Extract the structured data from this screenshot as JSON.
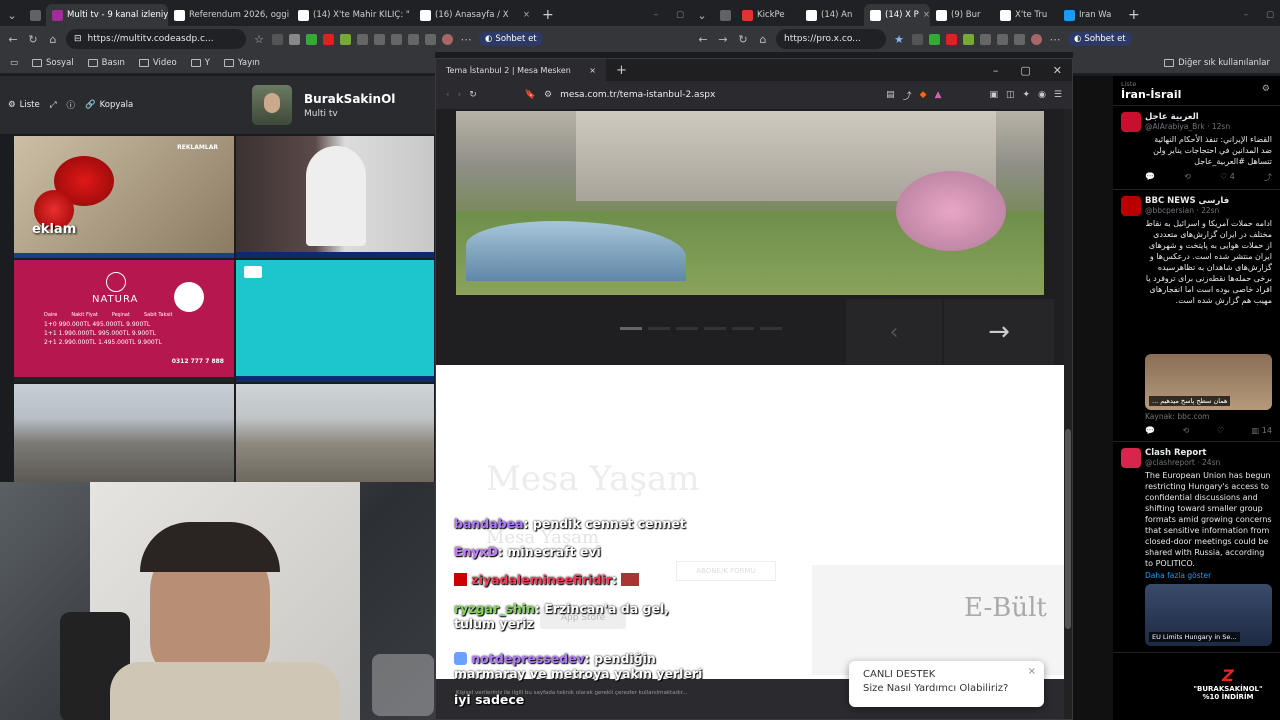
{
  "tabs_left": [
    {
      "label": "",
      "color": "#5f6368"
    },
    {
      "label": "Multi tv - 9 kanal izleniy",
      "color": "#a52a9c",
      "active": true
    },
    {
      "label": "Referendum 2026, oggi",
      "color": "#ffffff"
    },
    {
      "label": "(14) X'te Mahir KILIÇ: \"",
      "color": "#ffffff"
    },
    {
      "label": "(16) Anasayfa / X",
      "color": "#ffffff"
    }
  ],
  "tabs_right": [
    {
      "label": "KickPe",
      "color": "#e0342c"
    },
    {
      "label": "(14) An",
      "color": "#ffffff"
    },
    {
      "label": "(14) X P",
      "color": "#ffffff",
      "active": true
    },
    {
      "label": "(9) Bur",
      "color": "#ffffff"
    },
    {
      "label": "X'te Tru",
      "color": "#ffffff"
    },
    {
      "label": "Iran Wa",
      "color": "#1d9bf0"
    }
  ],
  "url_left": "https://multitv.codeasdp.c...",
  "url_right": "https://pro.x.co...",
  "chat_button": "Sohbet et",
  "bookmarks": [
    "Sosyal",
    "Basın",
    "Video",
    "Y",
    "Yayın"
  ],
  "bookmarks_other": "Diğer sık kullanılanlar",
  "multitv": {
    "liste": "Liste",
    "kopyala": "Kopyala",
    "channel_name": "BurakSakinOl",
    "channel_sub": "Multi tv",
    "reklamlar": "REKLAMLAR",
    "reklam_text": "eklam",
    "natura": "NATURA",
    "natura_phone": "0312 777 7 888",
    "natura_rows": [
      {
        "type": "1+0",
        "price": "990.000TL",
        "down": "495.000TL",
        "monthly": "9.900TL"
      },
      {
        "type": "1+1",
        "price": "1.990.000TL",
        "down": "995.000TL",
        "monthly": "9.900TL"
      },
      {
        "type": "2+1",
        "price": "2.990.000TL",
        "down": "1.495.000TL",
        "monthly": "9.900TL"
      }
    ],
    "natura_headers": [
      "Daire",
      "Nakit Fiyat",
      "Peşinat",
      "Sabit Taksit"
    ]
  },
  "mesa": {
    "tab_title": "Tema İstanbul 2 | Mesa Mesken",
    "url": "mesa.com.tr/tema-istanbul-2.aspx",
    "watermark": "Mesa Yaşam",
    "subscribe": "ABONE/K FORMU",
    "store": "App Store",
    "ebulten": "E-Bült",
    "cookie": "Kişisel verileriniz ile ilgili bu sayfada teknik olarak gerekli çerezler kullanılmaktadır..."
  },
  "chat": [
    {
      "user": "bandabea",
      "user_color": "#b07cff",
      "msg": "pendik cennet cennet"
    },
    {
      "user": "EnyxD",
      "user_color": "#c77dff",
      "msg": "minecraft evi"
    },
    {
      "user": "ziyadaleminеefiridir",
      "user_color": "#ff3b5c",
      "msg": ""
    },
    {
      "user": "ryzgar_shin",
      "user_color": "#7ed957",
      "msg": "Erzincan'a da gel, tulum yeriz"
    },
    {
      "user": "notdepressedev",
      "user_color": "#b07cff",
      "msg": "pendiğin marmaray ve metroya yakın yerleri"
    },
    {
      "user": "",
      "user_color": "#fff",
      "msg": "iyi sadece"
    }
  ],
  "live_support": {
    "title": "CANLI DESTEK",
    "subtitle": "Size Nasıl Yardımcı Olabiliriz?"
  },
  "twitter": {
    "list_label": "Liste",
    "list_title": "İran-İsrail",
    "tweets": [
      {
        "name": "العربية عاجل",
        "handle": "@AlArabiya_Brk · 12sn",
        "text": "القضاء الإيراني: تنفذ الأحكام النهائية ضد المدانين في احتجاجات يناير ولن تتساهل #العربية_عاجل",
        "avatar_color": "#c8102e",
        "counts": [
          "",
          "",
          "4",
          ""
        ]
      },
      {
        "name": "BBC NEWS فارسی",
        "handle": "@bbcpersian · 22sn",
        "text": "ادامه حملات آمریکا و اسرائیل به نقاط مختلف در ایران گزارش‌های متعددی از حملات هوایی به پایتخت و شهرهای ایران منتشر شده است. درعکس‌ها و گزارش‌های شاهدان به تظاهرسیده برخی حمله‌ها نقطه‌زنی برای تروفرد یا افراد خاصی بوده است اما انفجارهای مهیب هم گزارش شده است.",
        "avatar_color": "#b80000",
        "media_caption": "... همان سطح پاسخ میدهیم",
        "source": "Kaynak: bbc.com",
        "counts": [
          "",
          "",
          "",
          "14"
        ]
      },
      {
        "name": "Clash Report",
        "handle": "@clashreport · 24sn",
        "text": "The European Union has begun restricting Hungary's access to confidential discussions and shifting toward smaller group formats amid growing concerns that sensitive information from closed-door meetings could be shared with Russia, according to POLITICO.",
        "avatar_color": "#d6264b",
        "more": "Daha fazla göster",
        "media_caption": "EU Limits Hungary in Se..."
      }
    ]
  },
  "promo": {
    "line1": "\"BURAKSAKİNOL\"",
    "line2": "%10 İNDİRİM"
  }
}
